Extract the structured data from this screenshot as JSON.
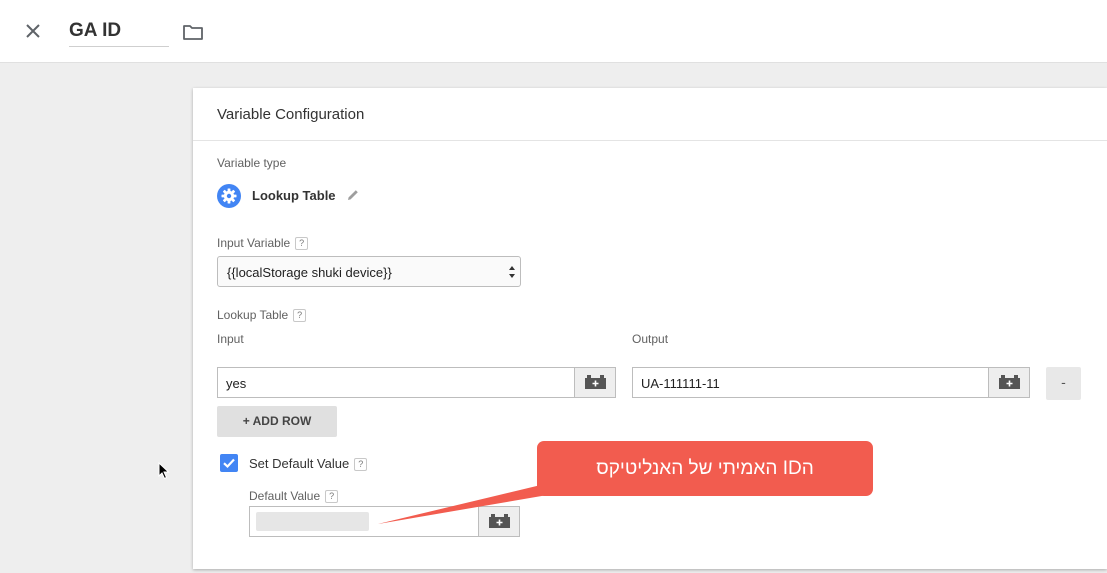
{
  "header": {
    "title": "GA ID",
    "close_icon": "close-icon",
    "folder_icon": "folder-icon"
  },
  "card": {
    "title": "Variable Configuration",
    "variable_type_label": "Variable type",
    "variable_type_name": "Lookup Table",
    "variable_type_icon": "gear-icon",
    "input_variable_label": "Input Variable",
    "input_variable_value": "{{localStorage shuki device}}",
    "lookup_table_label": "Lookup Table",
    "input_column_label": "Input",
    "output_column_label": "Output",
    "rows": [
      {
        "input": "yes",
        "output": "UA-111111-11"
      }
    ],
    "remove_label": "-",
    "add_row_label": "+ ADD ROW",
    "set_default_label": "Set Default Value",
    "set_default_checked": true,
    "default_value_label": "Default Value",
    "default_value": "",
    "help_glyph": "?"
  },
  "callout": {
    "text": "הID האמיתי של האנליטיקס",
    "color": "#f25c4f"
  },
  "colors": {
    "accent": "#4285f4",
    "background": "#eeeeee"
  }
}
